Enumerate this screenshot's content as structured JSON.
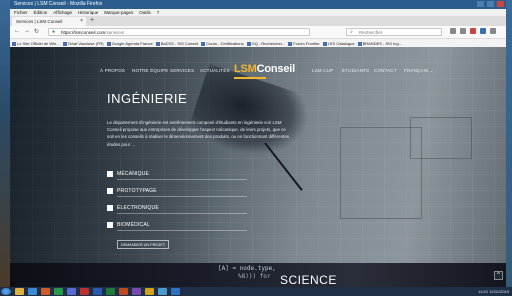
{
  "browser": {
    "window_title": "Services | LSM Conseil - Mozilla Firefox",
    "menu": [
      "Fichier",
      "Édition",
      "Affichage",
      "Historique",
      "Marque-pages",
      "Outils",
      "?"
    ],
    "tab_title": "Services | LSM Conseil",
    "url_domain": "https://lsmconseil.com",
    "url_path": "/services/",
    "search_placeholder": "Rechercher",
    "bookmarks": [
      "Le Site Officiel de Win...",
      "Tchat Vaucluse (FR)",
      "Google Agenda France",
      "BaDSS - SIS Conseil",
      "Cours - Certifications",
      "GQ - Rechercher...",
      "Forum Frontier",
      "LES Catalogue",
      "BRANDES - SIS Ing..."
    ]
  },
  "site": {
    "nav_left": [
      "À PROPOS",
      "NOTRE ÉQUIPE",
      "SERVICES",
      "ACTUALITÉS"
    ],
    "logo_prefix": "LSM",
    "logo_suffix": "Conseil",
    "nav_right": [
      "LSM CUP",
      "ÉTUDIANTS",
      "CONTACT",
      "FRANÇAIS ⌄"
    ]
  },
  "hero": {
    "title": "INGÉNIERIE",
    "intro": "Le département d'ingénierie est extrêmement composé d'étudiants en ingénierie voir LSM Conseil propose aux entreprises de développer l'aspect mécanique, de leurs projets, que ce soit en les conseils à réaliser le dimensionnement des produits, ou en fonctionnant différentes études pour ...",
    "categories": [
      "MÉCANIQUE",
      "PROTOTYPAGE",
      "ÉLECTRONIQUE",
      "BIOMÉDICAL"
    ],
    "cta": "DEMANDER UN PROJET",
    "code_line1": "[A] = node.type,",
    "code_line2": "%8))) for",
    "section_next": "SCIENCE",
    "fab": "^"
  },
  "taskbar": {
    "clock": "14:21",
    "date": "12/11/2019"
  }
}
